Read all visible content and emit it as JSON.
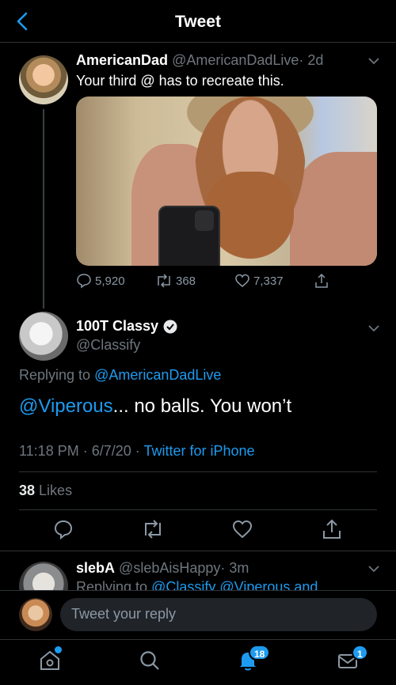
{
  "header": {
    "title": "Tweet"
  },
  "parent_tweet": {
    "author_name": "AmericanDad",
    "author_handle": "@AmericanDadLive",
    "time": "· 2d",
    "text": "Your third @ has to recreate this.",
    "replies": "5,920",
    "retweets": "368",
    "likes": "7,337"
  },
  "main_tweet": {
    "author_name": "100T Classy",
    "author_handle": "@Classify",
    "replying_label": "Replying to",
    "replying_handle": "@AmericanDadLive",
    "mention": "@Viperous",
    "text": "... no balls. You won’t",
    "timestamp": "11:18 PM · 6/7/20 ·",
    "client": "Twitter for iPhone",
    "likes_count": "38",
    "likes_label": "Likes"
  },
  "next_reply": {
    "author_name": "slebA",
    "author_handle": "@slebAisHappy",
    "time": "· 3m",
    "replying_label": "Replying to",
    "replying_handles": "@Classify @Viperous and"
  },
  "composer": {
    "placeholder": "Tweet your reply"
  },
  "nav": {
    "notifications_badge": "18",
    "messages_badge": "1"
  },
  "colors": {
    "accent": "#1d9bf0",
    "background": "#000000"
  }
}
